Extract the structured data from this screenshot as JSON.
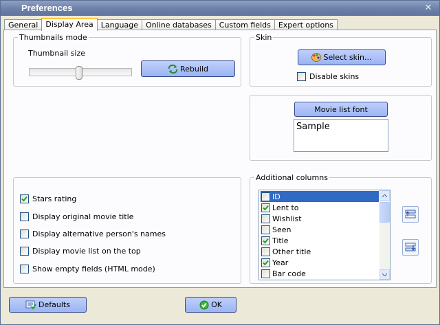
{
  "window": {
    "title": "Preferences",
    "close_glyph": "✕"
  },
  "tabs": [
    {
      "label": "General",
      "active": false
    },
    {
      "label": "Display Area",
      "active": true
    },
    {
      "label": "Language",
      "active": false
    },
    {
      "label": "Online databases",
      "active": false
    },
    {
      "label": "Custom fields",
      "active": false
    },
    {
      "label": "Expert options",
      "active": false
    }
  ],
  "thumbnails": {
    "group_label": "Thumbnails mode",
    "size_label": "Thumbnail size",
    "slider_value": 0.5,
    "rebuild_label": "Rebuild",
    "rebuild_icon": "refresh-icon"
  },
  "skin": {
    "group_label": "Skin",
    "select_label": "Select skin...",
    "select_icon": "palette-icon",
    "disable_label": "Disable skins",
    "disable_checked": false
  },
  "font": {
    "button_label": "Movie list font",
    "sample_text": "Sample"
  },
  "options": [
    {
      "label": "Stars rating",
      "checked": true
    },
    {
      "label": "Display original movie title",
      "checked": false
    },
    {
      "label": "Display alternative person's names",
      "checked": false
    },
    {
      "label": "Display movie list on the top",
      "checked": false
    },
    {
      "label": "Show empty fields (HTML mode)",
      "checked": false
    }
  ],
  "columns": {
    "group_label": "Additional columns",
    "items": [
      {
        "label": "ID",
        "checked": false,
        "selected": true
      },
      {
        "label": "Lent to",
        "checked": true,
        "selected": false
      },
      {
        "label": "Wishlist",
        "checked": false,
        "selected": false
      },
      {
        "label": "Seen",
        "checked": false,
        "selected": false
      },
      {
        "label": "Title",
        "checked": true,
        "selected": false
      },
      {
        "label": "Other title",
        "checked": false,
        "selected": false
      },
      {
        "label": "Year",
        "checked": true,
        "selected": false
      },
      {
        "label": "Bar code",
        "checked": false,
        "selected": false
      }
    ],
    "move_up_icon": "move-up-icon",
    "move_down_icon": "move-down-icon"
  },
  "footer": {
    "defaults_label": "Defaults",
    "defaults_icon": "defaults-icon",
    "ok_label": "OK",
    "ok_icon": "check-icon"
  },
  "colors": {
    "accent": "#316ac5",
    "check": "#21a121",
    "button": "#a9bff6",
    "title_bar": "#7386ad"
  }
}
